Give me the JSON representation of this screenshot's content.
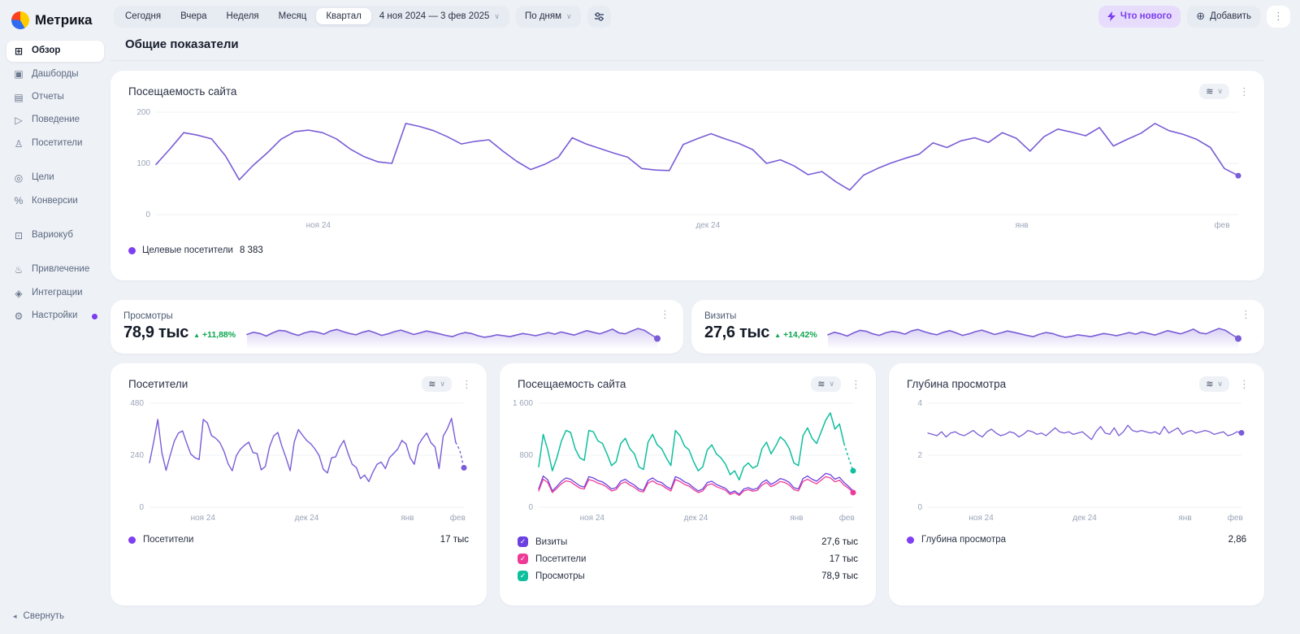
{
  "brand": {
    "name": "Метрика"
  },
  "topbar": {
    "ranges": [
      "Сегодня",
      "Вчера",
      "Неделя",
      "Месяц",
      "Квартал"
    ],
    "active_range": "Квартал",
    "date_range": "4 ноя 2024 — 3 фев 2025",
    "granularity": "По дням",
    "whats_new_label": "Что нового",
    "add_label": "Добавить"
  },
  "sidebar": {
    "groups": [
      [
        {
          "label": "Обзор",
          "icon": "overview-grid-icon",
          "glyph": "⊞",
          "active": true
        },
        {
          "label": "Дашборды",
          "icon": "dashboards-icon",
          "glyph": "▣"
        },
        {
          "label": "Отчеты",
          "icon": "reports-icon",
          "glyph": "▤"
        },
        {
          "label": "Поведение",
          "icon": "behavior-play-icon",
          "glyph": "▷"
        },
        {
          "label": "Посетители",
          "icon": "visitors-person-icon",
          "glyph": "♙"
        }
      ],
      [
        {
          "label": "Цели",
          "icon": "goals-target-icon",
          "glyph": "◎"
        },
        {
          "label": "Конверсии",
          "icon": "conversions-percent-icon",
          "glyph": "%"
        }
      ],
      [
        {
          "label": "Вариокуб",
          "icon": "variocube-icon",
          "glyph": "⊡"
        }
      ],
      [
        {
          "label": "Привлечение",
          "icon": "attraction-flame-icon",
          "glyph": "♨"
        },
        {
          "label": "Интеграции",
          "icon": "integrations-icon",
          "glyph": "◈"
        },
        {
          "label": "Настройки",
          "icon": "settings-gear-icon",
          "glyph": "⚙",
          "badge": true
        }
      ]
    ],
    "collapse_label": "Свернуть"
  },
  "page": {
    "title": "Общие показатели"
  },
  "cards": {
    "main": {
      "title": "Посещаемость сайта",
      "legend_label": "Целевые посетители",
      "legend_value": "8 383"
    },
    "views": {
      "title": "Просмотры",
      "value": "78,9 тыс",
      "delta": "+11,88%"
    },
    "visits": {
      "title": "Визиты",
      "value": "27,6 тыс",
      "delta": "+14,42%"
    },
    "visitors": {
      "title": "Посетители",
      "legend_label": "Посетители",
      "legend_value": "17 тыс"
    },
    "traffic": {
      "title": "Посещаемость сайта",
      "legend": [
        {
          "label": "Визиты",
          "value": "27,6 тыс",
          "color": "#6b40e0"
        },
        {
          "label": "Посетители",
          "value": "17 тыс",
          "color": "#ee3a97"
        },
        {
          "label": "Просмотры",
          "value": "78,9 тыс",
          "color": "#10bf9e"
        }
      ]
    },
    "depth": {
      "title": "Глубина просмотра",
      "legend_label": "Глубина просмотра",
      "legend_value": "2,86"
    }
  },
  "colors": {
    "purple": "#7a5cd6",
    "purple_dot": "#7e3ff2",
    "pink": "#ee3a97",
    "teal": "#10bf9e",
    "green": "#0ba64f",
    "grid": "#edf0f4",
    "axis_text": "#9aa4b8"
  },
  "chart_data": [
    {
      "id": "main-visitors",
      "type": "line",
      "axes": true,
      "title": "Посещаемость сайта",
      "ylim": [
        0,
        200
      ],
      "yticks": [
        {
          "v": 0,
          "label": "0"
        },
        {
          "v": 100,
          "label": "100"
        },
        {
          "v": 200,
          "label": "200"
        }
      ],
      "xticks": [
        {
          "label": "ноя 24",
          "pos": 0.15
        },
        {
          "label": "дек 24",
          "pos": 0.51
        },
        {
          "label": "янв",
          "pos": 0.8
        },
        {
          "label": "фев",
          "pos": 0.985
        }
      ],
      "series": [
        {
          "name": "Целевые посетители",
          "color": "#7a5cd6",
          "width": 1.6,
          "end_dot": true,
          "dash_tail": 0,
          "values": [
            98,
            128,
            160,
            155,
            148,
            115,
            68,
            96,
            120,
            147,
            162,
            165,
            160,
            148,
            128,
            113,
            103,
            100,
            178,
            172,
            164,
            152,
            138,
            143,
            146,
            124,
            104,
            88,
            98,
            112,
            150,
            138,
            129,
            120,
            112,
            90,
            87,
            86,
            137,
            148,
            158,
            148,
            139,
            127,
            100,
            107,
            95,
            78,
            84,
            64,
            48,
            77,
            90,
            101,
            110,
            118,
            140,
            131,
            144,
            150,
            141,
            160,
            149,
            124,
            152,
            167,
            161,
            154,
            170,
            134,
            147,
            159,
            178,
            164,
            157,
            147,
            131,
            90,
            76
          ]
        }
      ]
    },
    {
      "id": "views-spark",
      "type": "area",
      "axes": false,
      "ylim": [
        20,
        95
      ],
      "series": [
        {
          "name": "Просмотры",
          "color": "#7a5cd6",
          "width": 1.6,
          "fill": true,
          "end_dot": true,
          "values": [
            55,
            62,
            58,
            50,
            60,
            68,
            66,
            58,
            52,
            60,
            65,
            62,
            56,
            66,
            71,
            64,
            58,
            54,
            62,
            67,
            60,
            52,
            57,
            64,
            69,
            62,
            55,
            60,
            66,
            62,
            57,
            52,
            48,
            56,
            61,
            58,
            51,
            46,
            49,
            54,
            51,
            48,
            53,
            58,
            55,
            51,
            56,
            61,
            56,
            63,
            58,
            53,
            60,
            67,
            62,
            57,
            64,
            72,
            60,
            57,
            66,
            74,
            68,
            55,
            42
          ]
        }
      ]
    },
    {
      "id": "visits-spark",
      "type": "area",
      "axes": false,
      "ylim": [
        16,
        91
      ],
      "series": [
        {
          "name": "Визиты",
          "color": "#7a5cd6",
          "width": 1.6,
          "fill": true,
          "end_dot": true,
          "values": [
            50,
            58,
            53,
            46,
            56,
            64,
            61,
            53,
            48,
            56,
            61,
            58,
            52,
            62,
            67,
            60,
            54,
            50,
            58,
            63,
            56,
            48,
            53,
            60,
            65,
            58,
            51,
            56,
            62,
            58,
            53,
            48,
            44,
            52,
            57,
            54,
            47,
            42,
            45,
            50,
            47,
            44,
            49,
            54,
            51,
            47,
            52,
            57,
            52,
            59,
            54,
            49,
            56,
            63,
            58,
            53,
            60,
            68,
            56,
            53,
            62,
            70,
            64,
            51,
            38
          ]
        }
      ]
    },
    {
      "id": "visitors-small",
      "type": "line",
      "axes": true,
      "title": "Посетители",
      "ylim": [
        0,
        480
      ],
      "yticks": [
        {
          "v": 0,
          "label": "0"
        },
        {
          "v": 240,
          "label": "240"
        },
        {
          "v": 480,
          "label": "480"
        }
      ],
      "xticks": [
        {
          "label": "ноя 24",
          "pos": 0.17
        },
        {
          "label": "дек 24",
          "pos": 0.5
        },
        {
          "label": "янв",
          "pos": 0.82
        },
        {
          "label": "фев",
          "pos": 0.98
        }
      ],
      "series": [
        {
          "name": "Посетители",
          "color": "#7a5cd6",
          "width": 1.4,
          "end_dot": true,
          "dash_tail": 2,
          "values": [
            205,
            300,
            405,
            250,
            170,
            240,
            305,
            342,
            352,
            295,
            245,
            228,
            220,
            405,
            388,
            330,
            318,
            298,
            258,
            200,
            168,
            238,
            268,
            286,
            300,
            252,
            248,
            172,
            188,
            278,
            328,
            345,
            282,
            228,
            168,
            302,
            358,
            332,
            308,
            292,
            268,
            238,
            175,
            158,
            228,
            232,
            278,
            308,
            248,
            198,
            183,
            132,
            148,
            118,
            162,
            198,
            208,
            178,
            228,
            248,
            268,
            308,
            292,
            228,
            198,
            288,
            318,
            342,
            298,
            278,
            178,
            328,
            362,
            410,
            300,
            262,
            182
          ]
        }
      ]
    },
    {
      "id": "traffic-small",
      "type": "line",
      "axes": true,
      "title": "Посещаемость сайта",
      "ylim": [
        0,
        1600
      ],
      "yticks": [
        {
          "v": 0,
          "label": "0"
        },
        {
          "v": 800,
          "label": "800"
        },
        {
          "v": 1600,
          "label": "1 600"
        }
      ],
      "xticks": [
        {
          "label": "ноя 24",
          "pos": 0.17
        },
        {
          "label": "дек 24",
          "pos": 0.5
        },
        {
          "label": "янв",
          "pos": 0.82
        },
        {
          "label": "фев",
          "pos": 0.98
        }
      ],
      "series": [
        {
          "name": "Просмотры",
          "color": "#10bf9e",
          "width": 1.5,
          "end_dot": true,
          "dash_tail": 2,
          "values": [
            620,
            1120,
            880,
            560,
            760,
            1020,
            1180,
            1150,
            900,
            760,
            720,
            1180,
            1160,
            1020,
            980,
            820,
            640,
            700,
            980,
            1060,
            900,
            820,
            620,
            580,
            1000,
            1120,
            960,
            900,
            760,
            640,
            1180,
            1100,
            940,
            880,
            700,
            560,
            620,
            880,
            960,
            820,
            760,
            660,
            500,
            560,
            420,
            620,
            680,
            600,
            640,
            900,
            1000,
            820,
            940,
            1080,
            1020,
            900,
            680,
            640,
            1100,
            1220,
            1060,
            980,
            1160,
            1340,
            1450,
            1200,
            1280,
            980,
            760,
            560
          ]
        },
        {
          "name": "Визиты",
          "color": "#6b40e0",
          "width": 1.3,
          "end_dot": false,
          "dash_tail": 0,
          "values": [
            280,
            480,
            420,
            250,
            320,
            400,
            450,
            430,
            380,
            330,
            310,
            470,
            450,
            410,
            390,
            340,
            280,
            300,
            400,
            430,
            380,
            340,
            280,
            260,
            410,
            450,
            400,
            380,
            320,
            280,
            470,
            440,
            390,
            360,
            300,
            250,
            280,
            380,
            400,
            350,
            320,
            290,
            220,
            250,
            200,
            280,
            300,
            270,
            290,
            380,
            420,
            350,
            390,
            440,
            420,
            380,
            300,
            280,
            440,
            480,
            430,
            400,
            460,
            520,
            500,
            430,
            460,
            380,
            320,
            250
          ]
        },
        {
          "name": "Посетители",
          "color": "#ee3a97",
          "width": 1.3,
          "end_dot": true,
          "dash_tail": 0,
          "values": [
            250,
            430,
            380,
            225,
            290,
            360,
            405,
            390,
            340,
            295,
            280,
            425,
            405,
            370,
            350,
            305,
            250,
            270,
            360,
            390,
            340,
            305,
            250,
            235,
            370,
            405,
            360,
            340,
            290,
            250,
            425,
            395,
            350,
            325,
            270,
            225,
            250,
            340,
            360,
            315,
            290,
            260,
            195,
            225,
            180,
            250,
            270,
            245,
            260,
            340,
            380,
            315,
            350,
            395,
            380,
            340,
            270,
            250,
            395,
            430,
            390,
            360,
            415,
            470,
            450,
            390,
            415,
            340,
            290,
            225
          ]
        }
      ]
    },
    {
      "id": "depth-small",
      "type": "line",
      "axes": true,
      "title": "Глубина просмотра",
      "ylim": [
        0,
        4
      ],
      "yticks": [
        {
          "v": 0,
          "label": "0"
        },
        {
          "v": 2,
          "label": "2"
        },
        {
          "v": 4,
          "label": "4"
        }
      ],
      "xticks": [
        {
          "label": "ноя 24",
          "pos": 0.17
        },
        {
          "label": "дек 24",
          "pos": 0.5
        },
        {
          "label": "янв",
          "pos": 0.82
        },
        {
          "label": "фев",
          "pos": 0.98
        }
      ],
      "series": [
        {
          "name": "Глубина просмотра",
          "color": "#7a5cd6",
          "width": 1.3,
          "end_dot": true,
          "dash_tail": 0,
          "values": [
            2.85,
            2.8,
            2.75,
            2.9,
            2.7,
            2.85,
            2.9,
            2.8,
            2.75,
            2.85,
            2.95,
            2.8,
            2.7,
            2.9,
            3.0,
            2.85,
            2.75,
            2.8,
            2.9,
            2.85,
            2.7,
            2.8,
            2.95,
            2.9,
            2.8,
            2.85,
            2.75,
            2.9,
            3.05,
            2.9,
            2.85,
            2.9,
            2.8,
            2.85,
            2.9,
            2.75,
            2.6,
            2.9,
            3.1,
            2.85,
            2.8,
            3.05,
            2.75,
            2.9,
            3.15,
            2.95,
            2.9,
            2.95,
            2.9,
            2.85,
            2.9,
            2.8,
            3.1,
            2.85,
            2.95,
            3.05,
            2.8,
            2.9,
            2.95,
            2.85,
            2.9,
            2.95,
            2.9,
            2.8,
            2.85,
            2.9,
            2.75,
            2.8,
            2.9,
            2.86
          ]
        }
      ]
    }
  ]
}
